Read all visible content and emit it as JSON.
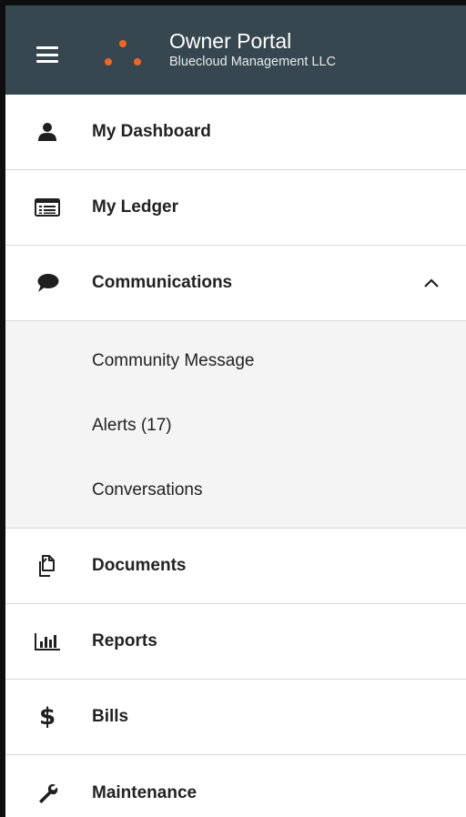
{
  "header": {
    "title": "Owner Portal",
    "subtitle": "Bluecloud Management LLC"
  },
  "menu": {
    "dashboard": {
      "label": "My Dashboard",
      "icon": "user-icon"
    },
    "ledger": {
      "label": "My Ledger",
      "icon": "ledger-icon"
    },
    "communications": {
      "label": "Communications",
      "icon": "chat-bubble-icon",
      "expanded": true,
      "children": {
        "community_message": {
          "label": "Community Message"
        },
        "alerts": {
          "label": "Alerts (17)"
        },
        "conversations": {
          "label": "Conversations"
        }
      }
    },
    "documents": {
      "label": "Documents",
      "icon": "documents-icon"
    },
    "reports": {
      "label": "Reports",
      "icon": "bar-chart-icon"
    },
    "bills": {
      "label": "Bills",
      "icon": "dollar-icon"
    },
    "maintenance": {
      "label": "Maintenance",
      "icon": "wrench-icon"
    }
  },
  "colors": {
    "header_bg": "#37474f",
    "accent": "#f26522",
    "submenu_bg": "#f4f4f4",
    "divider": "#d9d9d9"
  }
}
